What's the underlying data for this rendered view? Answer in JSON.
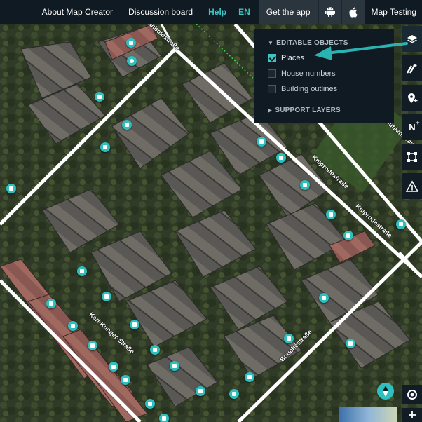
{
  "topbar": {
    "about": "About Map Creator",
    "discussion": "Discussion board",
    "help": "Help",
    "lang": "EN",
    "get_app": "Get the app",
    "map_testing": "Map Testing"
  },
  "layers_panel": {
    "editable_header": "EDITABLE OBJECTS",
    "items": [
      {
        "label": "Places",
        "checked": true
      },
      {
        "label": "House numbers",
        "checked": false
      },
      {
        "label": "Building outlines",
        "checked": false
      }
    ],
    "support_header": "SUPPORT LAYERS"
  },
  "toolbar": {
    "house_number_text": "N"
  },
  "streets": {
    "top": "Kahboldstraße",
    "kniprode_1": "Kniprodestraße",
    "kniprode_2": "Kniprodestraße",
    "karl_kunger": "Karl-Kunger-Straße",
    "bouche": "Bouchéstraße",
    "right_top": "Lohmühlenstraße"
  },
  "colors": {
    "accent": "#3fc4c2",
    "bar": "#0f1a22",
    "poi": "#2fbfbe"
  }
}
